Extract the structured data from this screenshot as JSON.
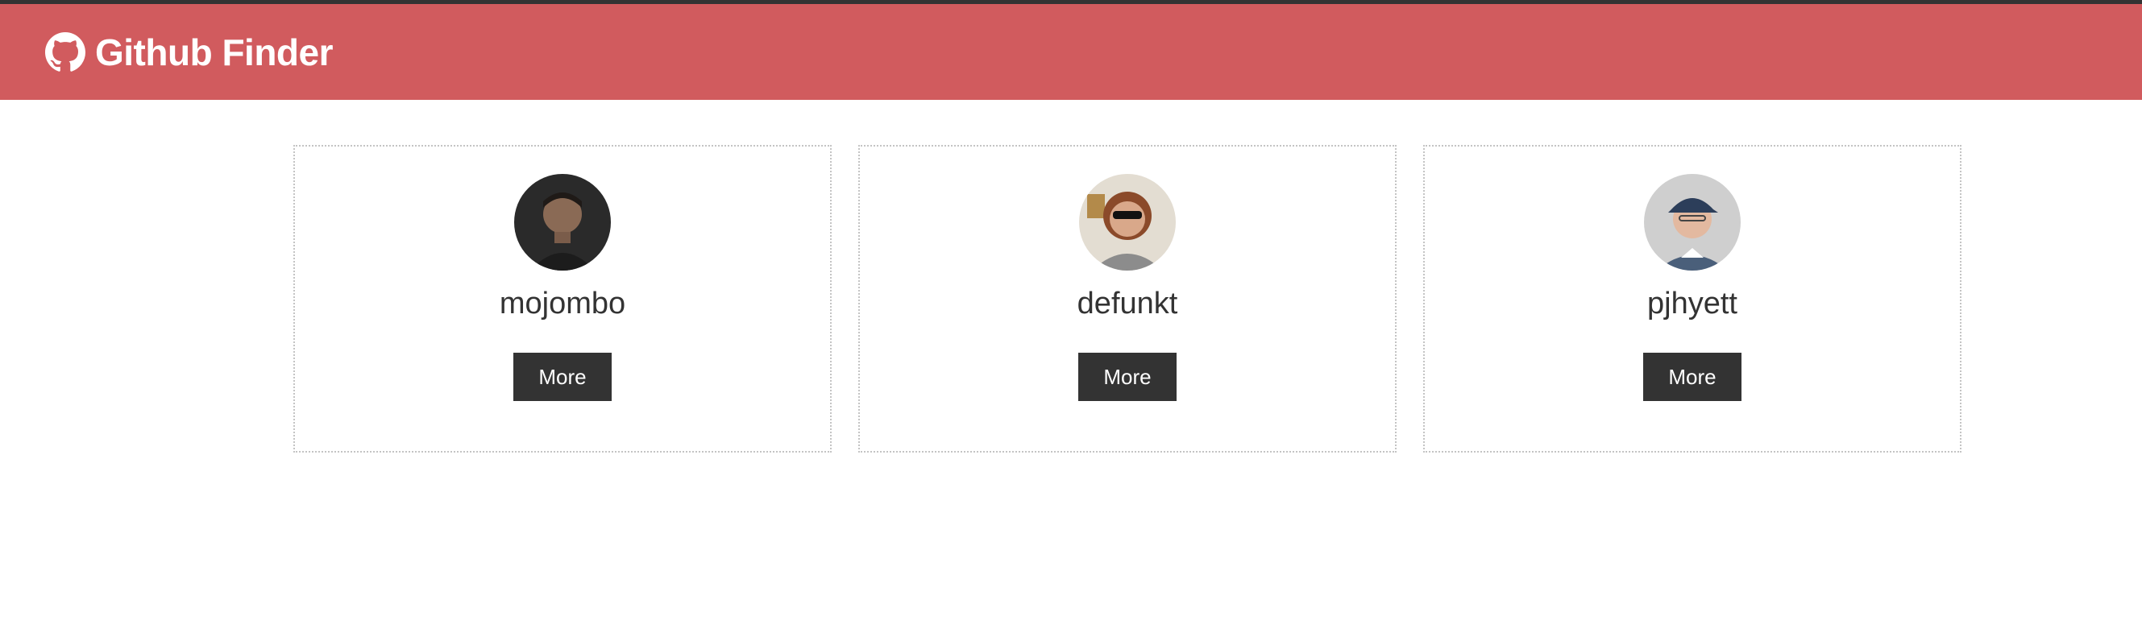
{
  "navbar": {
    "title": "Github Finder",
    "icon": "github-icon",
    "color": "#d15b5e"
  },
  "users": [
    {
      "login": "mojombo",
      "button_label": "More",
      "avatar": "avatar-photo"
    },
    {
      "login": "defunkt",
      "button_label": "More",
      "avatar": "avatar-photo"
    },
    {
      "login": "pjhyett",
      "button_label": "More",
      "avatar": "avatar-photo"
    }
  ]
}
